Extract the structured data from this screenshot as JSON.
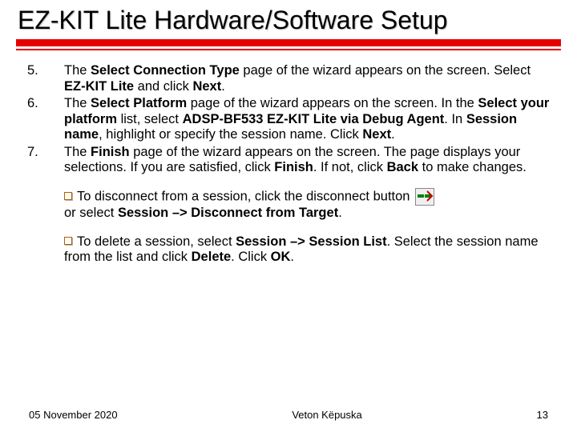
{
  "title": "EZ-KIT Lite Hardware/Software Setup",
  "steps": {
    "n5": "5.",
    "t5_a": "The ",
    "t5_b": "Select Connection Type",
    "t5_c": " page of the wizard appears on the screen. Select ",
    "t5_d": "EZ-KIT Lite",
    "t5_e": " and click ",
    "t5_f": "Next",
    "t5_g": ".",
    "n6": "6.",
    "t6_a": "The ",
    "t6_b": "Select Platform",
    "t6_c": " page of the wizard appears on the screen. In the ",
    "t6_d": "Select your platform",
    "t6_e": " list, select ",
    "t6_f": "ADSP-BF533 EZ-KIT Lite via Debug Agent",
    "t6_g": ". In ",
    "t6_h": "Session name",
    "t6_i": ", highlight or specify the session name. Click ",
    "t6_j": "Next",
    "t6_k": ".",
    "n7": "7.",
    "t7_a": "The ",
    "t7_b": "Finish",
    "t7_c": " page of the wizard appears on the screen. The page displays your selections. If you are satisfied, click ",
    "t7_d": "Finish",
    "t7_e": ". If not, click ",
    "t7_f": "Back",
    "t7_g": " to make changes."
  },
  "para1": {
    "a": "To disconnect from a session, click the disconnect button ",
    "b": "or select ",
    "c": "Session –> Disconnect from Target",
    "d": "."
  },
  "para2": {
    "a": "To delete a session, select ",
    "b": "Session –> Session List",
    "c": ". Select the session name from the list and click ",
    "d": "Delete",
    "e": ". Click ",
    "f": "OK",
    "g": "."
  },
  "footer": {
    "date": "05 November 2020",
    "author": "Veton Këpuska",
    "page": "13"
  }
}
